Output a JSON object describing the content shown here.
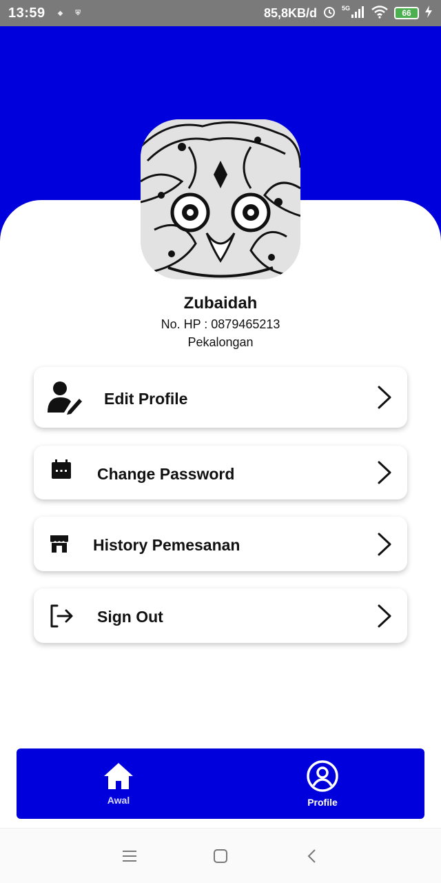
{
  "status_bar": {
    "time": "13:59",
    "network_speed": "85,8KB/d",
    "signal_label": "5G",
    "battery": "66",
    "icons": [
      "notification-icon",
      "shield-icon",
      "alarm-icon",
      "signal-icon",
      "wifi-icon",
      "battery-icon",
      "charging-icon"
    ]
  },
  "colors": {
    "primary": "#0000dc",
    "status_bar": "#7a7a7a",
    "battery_fill": "#4caf50"
  },
  "profile": {
    "name": "Zubaidah",
    "phone": "No. HP : 0879465213",
    "city": "Pekalongan",
    "avatar_icon": "batik-mask-avatar"
  },
  "menu": {
    "items": [
      {
        "label": "Edit Profile",
        "icon": "user-edit-icon"
      },
      {
        "label": "Change Password",
        "icon": "calendar-icon"
      },
      {
        "label": "History Pemesanan",
        "icon": "store-icon"
      },
      {
        "label": "Sign Out",
        "icon": "sign-out-icon"
      }
    ]
  },
  "bottom_nav": {
    "items": [
      {
        "label": "Awal",
        "icon": "home-icon",
        "active": false
      },
      {
        "label": "Profile",
        "icon": "profile-icon",
        "active": true
      }
    ]
  },
  "system_nav": {
    "icons": [
      "menu-icon",
      "home-square-icon",
      "back-icon"
    ]
  }
}
